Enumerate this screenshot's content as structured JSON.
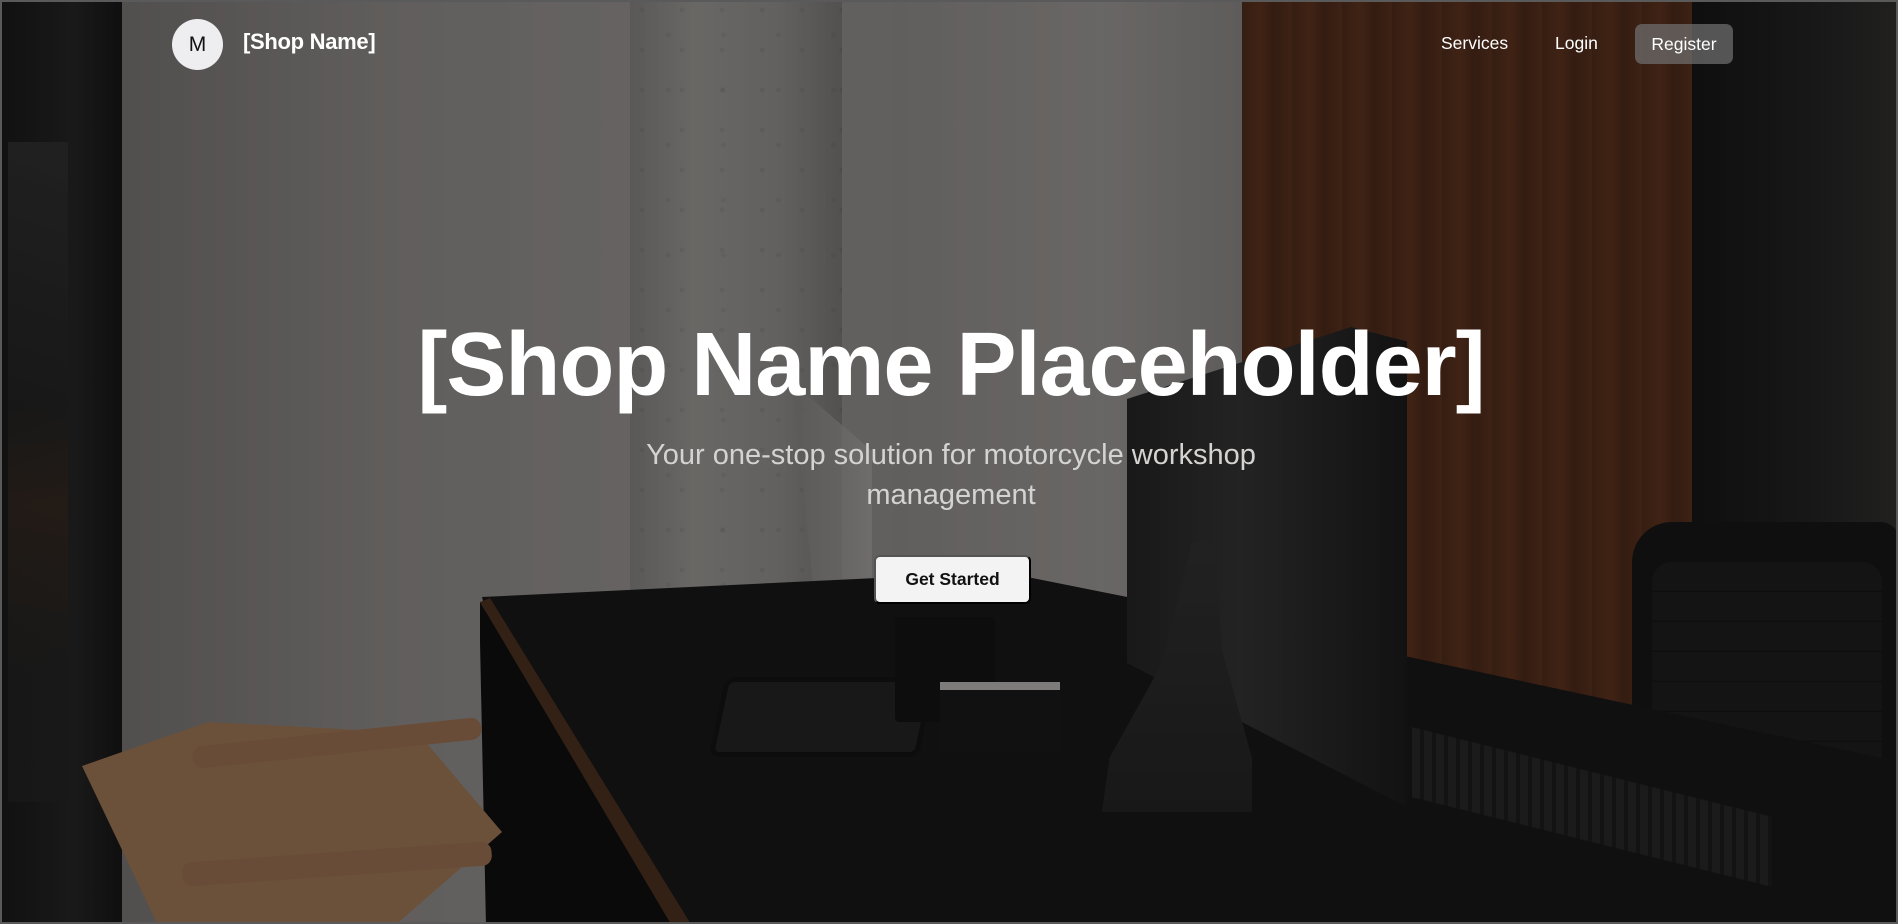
{
  "nav": {
    "logo_letter": "M",
    "brand": "[Shop Name]",
    "links": {
      "services": "Services",
      "login": "Login",
      "register": "Register"
    }
  },
  "hero": {
    "title": "[Shop Name Placeholder]",
    "subtitle": "Your one-stop solution for motorcycle workshop management",
    "cta": "Get Started"
  },
  "colors": {
    "cta_background": "#f3f3f3",
    "register_background": "#6e6c6c",
    "text": "#ffffff"
  }
}
